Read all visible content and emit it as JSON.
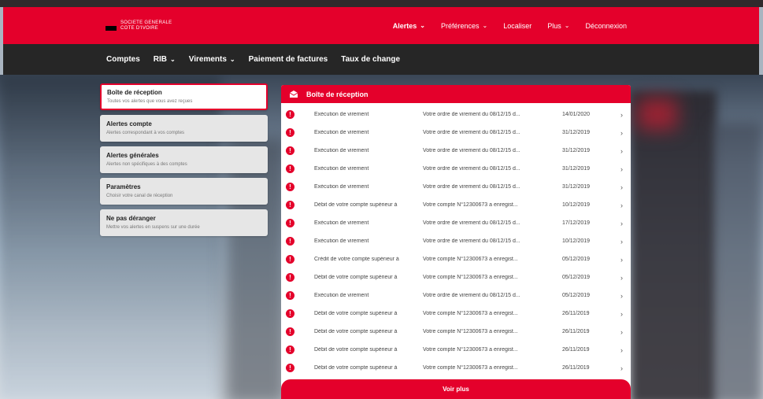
{
  "header": {
    "logo_line1": "SOCIETE GENERALE",
    "logo_line2": "COTE D'IVOIRE",
    "nav": [
      {
        "label": "Alertes",
        "has_dropdown": true,
        "bold": true
      },
      {
        "label": "Préférences",
        "has_dropdown": true
      },
      {
        "label": "Localiser",
        "has_dropdown": false
      },
      {
        "label": "Plus",
        "has_dropdown": true
      },
      {
        "label": "Déconnexion",
        "has_dropdown": false
      }
    ]
  },
  "mainnav": [
    {
      "label": "Comptes",
      "has_dropdown": false
    },
    {
      "label": "RIB",
      "has_dropdown": true
    },
    {
      "label": "Virements",
      "has_dropdown": true
    },
    {
      "label": "Paiement de factures",
      "has_dropdown": false
    },
    {
      "label": "Taux de change",
      "has_dropdown": false
    }
  ],
  "sidebar": [
    {
      "title": "Boîte de réception",
      "subtitle": "Toutes vos alertes que vous avez reçues",
      "active": true
    },
    {
      "title": "Alertes compte",
      "subtitle": "Alertes correspondant à vos comptes"
    },
    {
      "title": "Alertes générales",
      "subtitle": "Alertes non spécifiques à des comptes"
    },
    {
      "title": "Paramètres",
      "subtitle": "Choisir votre canal de réception"
    },
    {
      "title": "Ne pas déranger",
      "subtitle": "Mettre vos alertes en suspens sur une durée"
    }
  ],
  "inbox": {
    "title": "Boîte de réception",
    "rows": [
      {
        "subject": "Exécution de virement",
        "message": "Votre ordre de virement du 08/12/15 d...",
        "date": "14/01/2020"
      },
      {
        "subject": "Exécution de virement",
        "message": "Votre ordre de virement du 08/12/15 d...",
        "date": "31/12/2019"
      },
      {
        "subject": "Exécution de virement",
        "message": "Votre ordre de virement du 08/12/15 d...",
        "date": "31/12/2019"
      },
      {
        "subject": "Exécution de virement",
        "message": "Votre ordre de virement du 08/12/15 d...",
        "date": "31/12/2019"
      },
      {
        "subject": "Exécution de virement",
        "message": "Votre ordre de virement du 08/12/15 d...",
        "date": "31/12/2019"
      },
      {
        "subject": "Débit de votre compte supérieur à",
        "message": "Votre compte N°12300673 a enregist...",
        "date": "10/12/2019"
      },
      {
        "subject": "Exécution de virement",
        "message": "Votre ordre de virement du 08/12/15 d...",
        "date": "17/12/2019"
      },
      {
        "subject": "Exécution de virement",
        "message": "Votre ordre de virement du 08/12/15 d...",
        "date": "10/12/2019"
      },
      {
        "subject": "Crédit de votre compte supérieur à",
        "message": "Votre compte N°12300673 a enregist...",
        "date": "05/12/2019"
      },
      {
        "subject": "Débit de votre compte supérieur à",
        "message": "Votre compte N°12300673 a enregist...",
        "date": "05/12/2019"
      },
      {
        "subject": "Exécution de virement",
        "message": "Votre ordre de virement du 08/12/15 d...",
        "date": "05/12/2019"
      },
      {
        "subject": "Débit de votre compte supérieur à",
        "message": "Votre compte N°12300673 a enregist...",
        "date": "26/11/2019"
      },
      {
        "subject": "Débit de votre compte supérieur à",
        "message": "Votre compte N°12300673 a enregist...",
        "date": "26/11/2019"
      },
      {
        "subject": "Débit de votre compte supérieur à",
        "message": "Votre compte N°12300673 a enregist...",
        "date": "26/11/2019"
      },
      {
        "subject": "Débit de votre compte supérieur à",
        "message": "Votre compte N°12300673 a enregist...",
        "date": "26/11/2019"
      }
    ],
    "more_label": "Voir plus"
  },
  "colors": {
    "brand_red": "#e4002b",
    "nav_dark": "#262626",
    "logo_black": "#000000"
  },
  "icons": [
    "alert-icon",
    "envelope-icon",
    "chevron-down-icon",
    "chevron-right-icon"
  ]
}
